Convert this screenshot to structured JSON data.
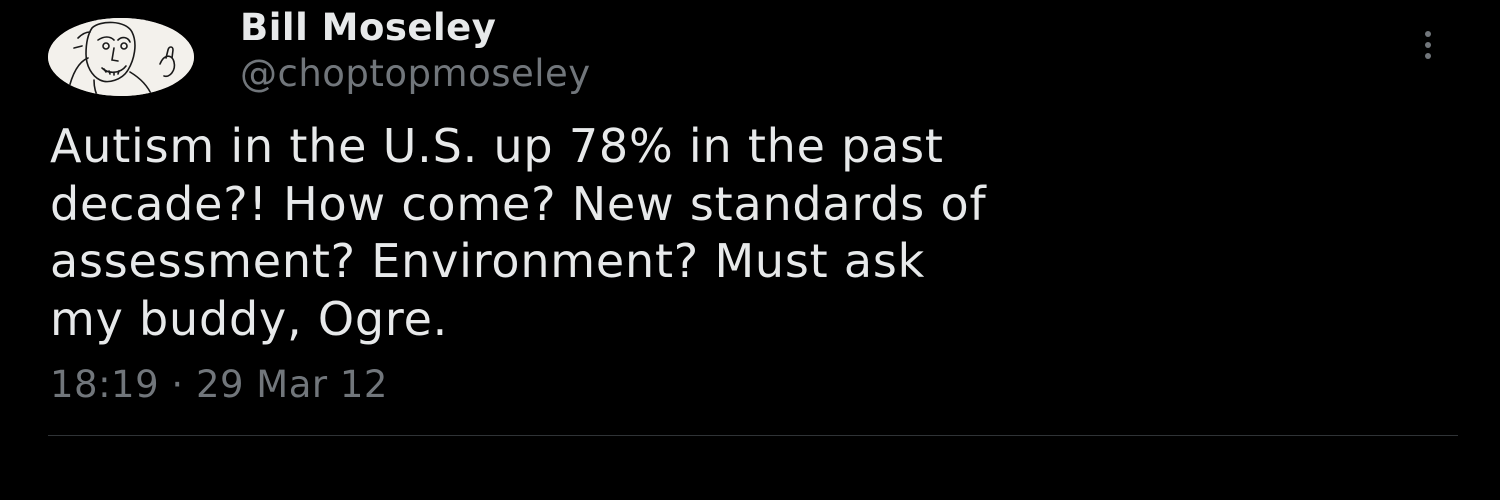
{
  "author": {
    "display_name": "Bill Moseley",
    "handle": "@choptopmoseley",
    "avatar_icon": "avatar-sketch-icon"
  },
  "tweet": {
    "text_lines": [
      "Autism in the U.S. up 78% in the past",
      "decade?! How come? New standards of",
      "assessment? Environment? Must ask",
      "my buddy, Ogre."
    ],
    "time": "18:19",
    "separator": "·",
    "date": "29 Mar 12"
  },
  "menu": {
    "icon": "more-vertical-icon"
  },
  "colors": {
    "background": "#000000",
    "primary_text": "#e7e9ea",
    "secondary_text": "#71767b",
    "divider": "#2f3336"
  }
}
